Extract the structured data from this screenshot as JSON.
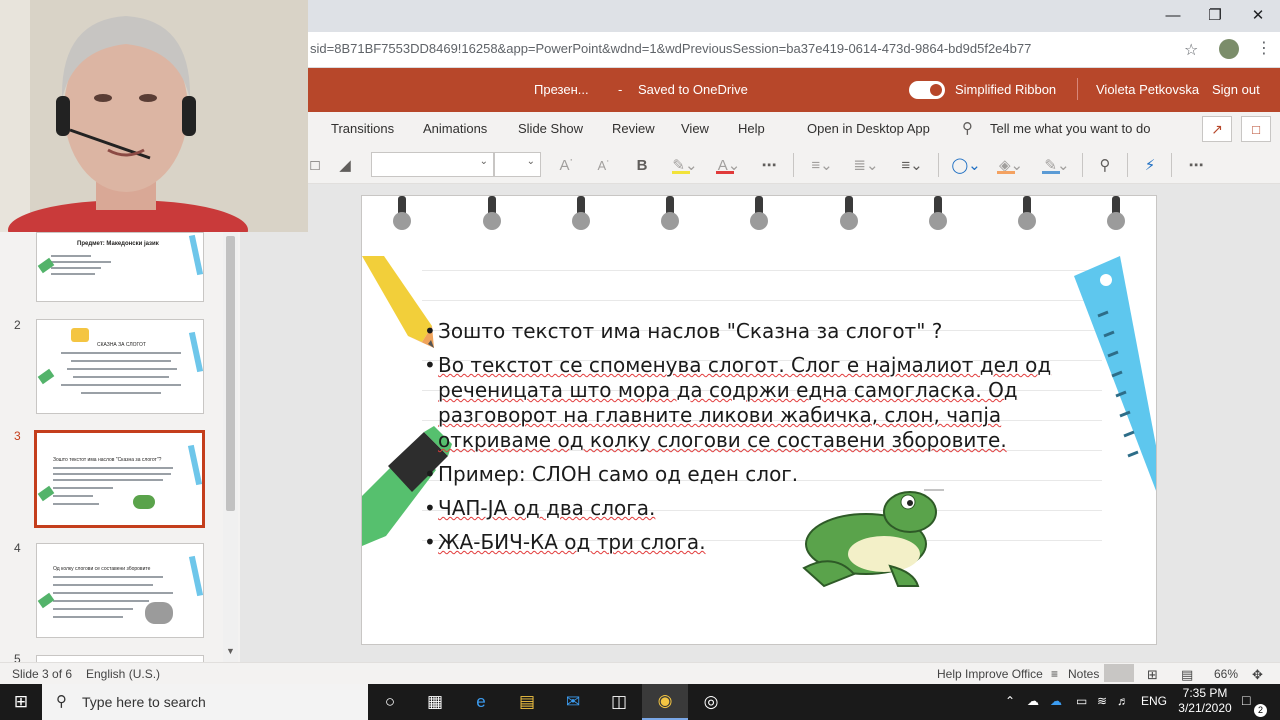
{
  "browser": {
    "url": "sid=8B71BF7553DD8469!16258&app=PowerPoint&wdnd=1&wdPreviousSession=ba37e419-0614-473d-9864-bd9d5f2e4b77",
    "window_controls": [
      "minimize-icon",
      "restore-icon",
      "close-icon"
    ]
  },
  "header": {
    "doc_title": "Презен...",
    "separator": "-",
    "save_status": "Saved to OneDrive",
    "simplified_ribbon_label": "Simplified Ribbon",
    "simplified_ribbon_on": true,
    "user_name": "Violeta Petkovska",
    "sign_out": "Sign out",
    "brand_color": "#b7472a"
  },
  "ribbon": {
    "tabs": [
      "Transitions",
      "Animations",
      "Slide Show",
      "Review",
      "View",
      "Help",
      "Open in Desktop App"
    ],
    "tell_me": "Tell me what you want to do",
    "tools": [
      "layout-icon",
      "shape-icon",
      "font-dropdown",
      "font-size-dropdown",
      "increase-font-icon",
      "decrease-font-icon",
      "bold-icon",
      "highlight-icon",
      "font-color-icon",
      "more-icon",
      "bullets-icon",
      "numbering-icon",
      "align-icon",
      "shapes-icon",
      "fill-icon",
      "outline-icon",
      "find-icon",
      "designer-icon",
      "more-options-icon"
    ]
  },
  "thumbnails": [
    {
      "number": "",
      "title": "Предмет: Македонски јазик"
    },
    {
      "number": "2",
      "title": "СКАЗНА ЗА СЛОГОТ"
    },
    {
      "number": "3",
      "title": "Зошто текстот има наслов \"Сказна за слогот\"?",
      "selected": true
    },
    {
      "number": "4",
      "title": "Од колку слогови се составени зборовите"
    },
    {
      "number": "5",
      "title": ""
    }
  ],
  "slide": {
    "bullets": [
      " Зошто текстот има наслов \"Сказна за слогот\" ?",
      "Во текстот се споменува слогот. Слог е најмалиот дел од реченицата што мора да содржи една самогласка. Од разговорот на главните ликови жабичка, слон, чапја откриваме од колку слогови се составени зборовите.",
      "Пример: СЛОН само од еден слог.",
      "ЧАП-ЈА од два слога.",
      "ЖА-БИЧ-КА од три слога."
    ]
  },
  "status": {
    "slide_info": "Slide 3 of 6",
    "language": "English (U.S.)",
    "help": "Help Improve Office",
    "notes": "Notes",
    "zoom": "66%"
  },
  "taskbar": {
    "search_placeholder": "Type here to search",
    "lang": "ENG",
    "time": "7:35 PM",
    "date": "3/21/2020",
    "notifications": "2"
  }
}
